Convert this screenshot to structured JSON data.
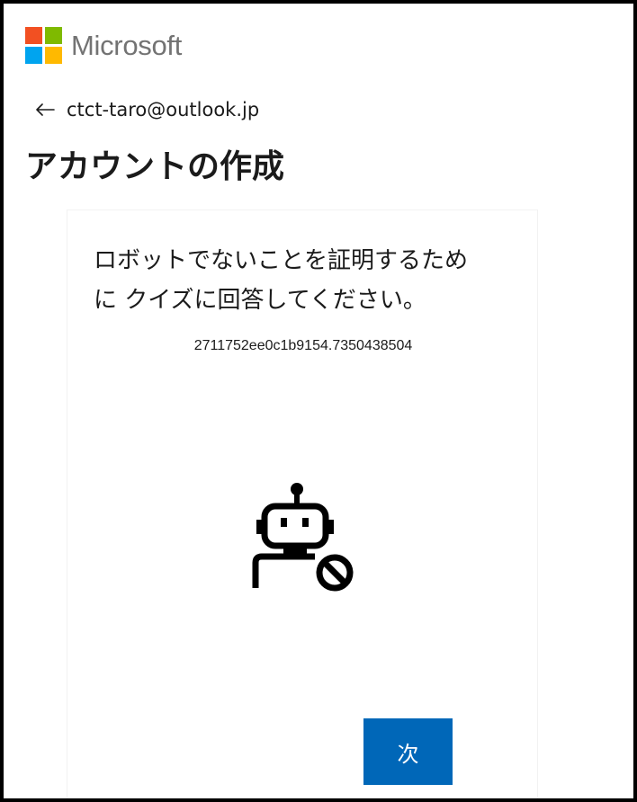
{
  "header": {
    "brand_name": "Microsoft",
    "logo_colors": [
      "#f25022",
      "#7fba00",
      "#00a4ef",
      "#ffb900"
    ]
  },
  "identity": {
    "back_icon": "left-arrow-icon",
    "email": "ctct-taro@outlook.jp"
  },
  "page": {
    "title": "アカウントの作成"
  },
  "challenge": {
    "instruction_line1": "ロボットでないことを証明するため",
    "instruction_line2": "に クイズに回答してください。",
    "session_id": "2711752ee0c1b9154.7350438504",
    "icon": "robot-blocked-icon",
    "next_label": "次"
  },
  "colors": {
    "accent": "#0067b8",
    "text": "#1b1b1b",
    "wordmark": "#737373"
  }
}
